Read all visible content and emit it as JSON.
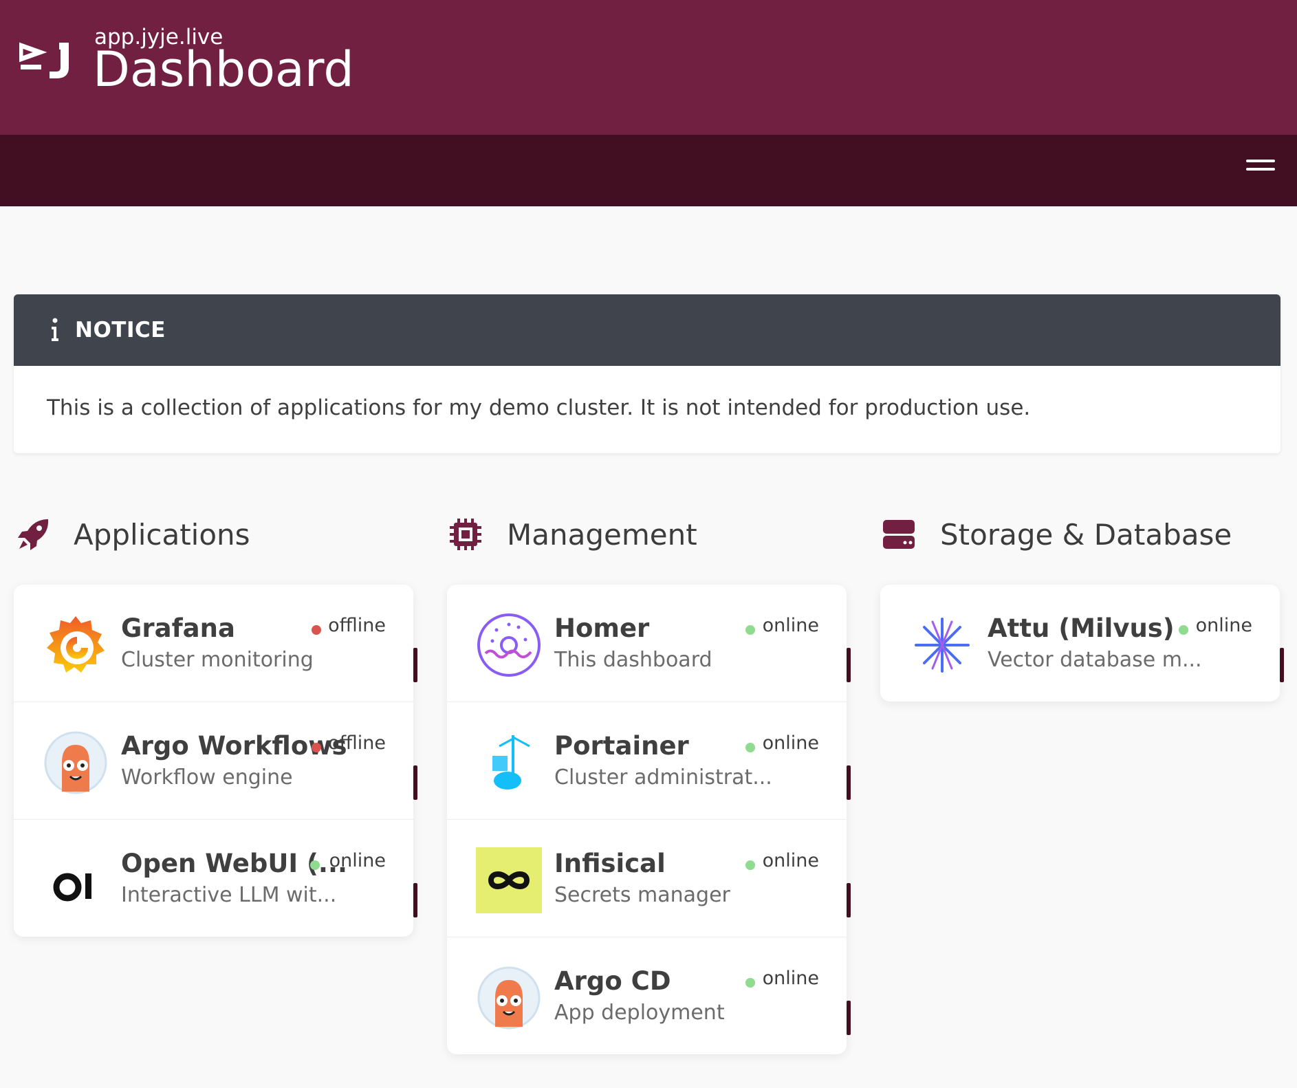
{
  "header": {
    "subtitle": "app.jyje.live",
    "title": "Dashboard"
  },
  "notice": {
    "title": "NOTICE",
    "body": "This is a collection of applications for my demo cluster. It is not intended for production use."
  },
  "colors": {
    "primary": "#722042",
    "navbar": "#410f21",
    "notice_header": "#40444c",
    "online": "#8fdb8f",
    "offline": "#d9534f"
  },
  "groups": [
    {
      "name": "Applications",
      "icon": "rocket-icon",
      "items": [
        {
          "name": "Grafana",
          "subtitle": "Cluster monitoring",
          "status": "offline",
          "icon": "grafana-icon"
        },
        {
          "name": "Argo Workflows",
          "subtitle": "Workflow engine",
          "status": "offline",
          "icon": "argo-icon"
        },
        {
          "name": "Open WebUI (...",
          "subtitle": "Interactive LLM wit...",
          "status": "online",
          "icon": "openwebui-icon"
        }
      ]
    },
    {
      "name": "Management",
      "icon": "chip-icon",
      "items": [
        {
          "name": "Homer",
          "subtitle": "This dashboard",
          "status": "online",
          "icon": "homer-icon"
        },
        {
          "name": "Portainer",
          "subtitle": "Cluster administrat...",
          "status": "online",
          "icon": "portainer-icon"
        },
        {
          "name": "Infisical",
          "subtitle": "Secrets manager",
          "status": "online",
          "icon": "infisical-icon"
        },
        {
          "name": "Argo CD",
          "subtitle": "App deployment",
          "status": "online",
          "icon": "argocd-icon"
        }
      ]
    },
    {
      "name": "Storage & Database",
      "icon": "server-icon",
      "items": [
        {
          "name": "Attu (Milvus)",
          "subtitle": "Vector database m...",
          "status": "online",
          "icon": "milvus-icon"
        }
      ]
    }
  ]
}
